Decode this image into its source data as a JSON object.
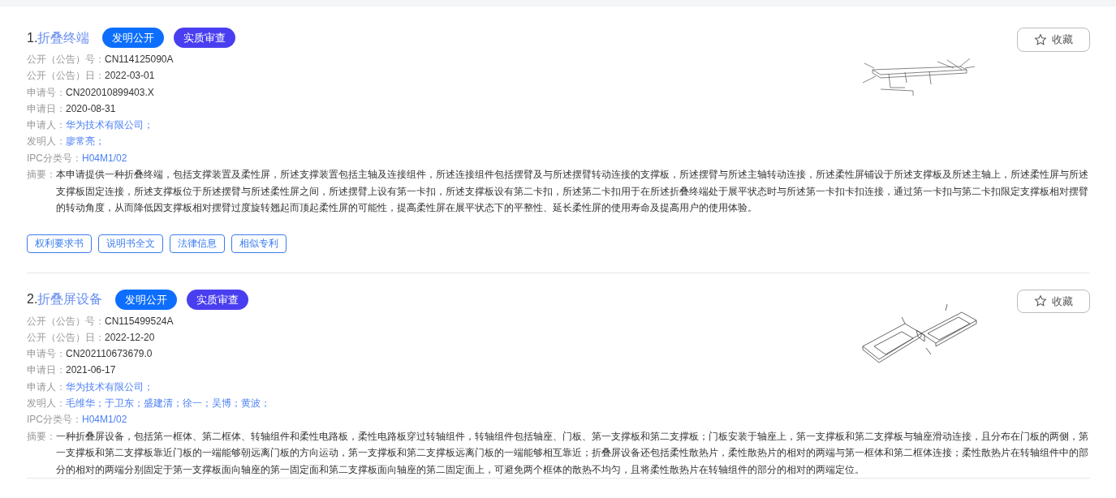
{
  "results": [
    {
      "index": "1.",
      "title": "折叠终端",
      "tags": [
        {
          "label": "发明公开",
          "color": "#0d6efd"
        },
        {
          "label": "实质审查",
          "color": "#4a3ff0"
        }
      ],
      "favorite": "收藏",
      "fields": [
        {
          "label": "公开（公告）号：",
          "kind": "plain",
          "values": [
            "CN114125090A"
          ]
        },
        {
          "label": "公开（公告）日：",
          "kind": "plain",
          "values": [
            "2022-03-01"
          ]
        },
        {
          "label": "申请号：",
          "kind": "plain",
          "values": [
            "CN202010899403.X"
          ]
        },
        {
          "label": "申请日：",
          "kind": "plain",
          "values": [
            "2020-08-31"
          ]
        },
        {
          "label": "申请人：",
          "kind": "link",
          "values": [
            "华为技术有限公司；"
          ]
        },
        {
          "label": "发明人：",
          "kind": "link",
          "values": [
            "廖常亮；"
          ]
        },
        {
          "label": "IPC分类号：",
          "kind": "link",
          "values": [
            "H04M1/02"
          ]
        }
      ],
      "abstract_label": "摘要：",
      "abstract": "本申请提供一种折叠终端，包括支撑装置及柔性屏，所述支撑装置包括主轴及连接组件，所述连接组件包括摆臂及与所述摆臂转动连接的支撑板，所述摆臂与所述主轴转动连接，所述柔性屏铺设于所述支撑板及所述主轴上，所述柔性屏与所述支撑板固定连接，所述支撑板位于所述摆臂与所述柔性屏之间，所述摆臂上设有第一卡扣，所述支撑板设有第二卡扣，所述第二卡扣用于在所述折叠终端处于展平状态时与所述第一卡扣卡扣连接，通过第一卡扣与第二卡扣限定支撑板相对摆臂的转动角度，从而降低因支撑板相对摆臂过度旋转翘起而顶起柔性屏的可能性，提高柔性屏在展平状态下的平整性、延长柔性屏的使用寿命及提高用户的使用体验。",
      "kind": "flat",
      "actions": [
        "权利要求书",
        "说明书全文",
        "法律信息",
        "相似专利"
      ]
    },
    {
      "index": "2.",
      "title": "折叠屏设备",
      "tags": [
        {
          "label": "发明公开",
          "color": "#0d6efd"
        },
        {
          "label": "实质审查",
          "color": "#4a3ff0"
        }
      ],
      "favorite": "收藏",
      "fields": [
        {
          "label": "公开（公告）号：",
          "kind": "plain",
          "values": [
            "CN115499524A"
          ]
        },
        {
          "label": "公开（公告）日：",
          "kind": "plain",
          "values": [
            "2022-12-20"
          ]
        },
        {
          "label": "申请号：",
          "kind": "plain",
          "values": [
            "CN202110673679.0"
          ]
        },
        {
          "label": "申请日：",
          "kind": "plain",
          "values": [
            "2021-06-17"
          ]
        },
        {
          "label": "申请人：",
          "kind": "link",
          "values": [
            "华为技术有限公司；"
          ]
        },
        {
          "label": "发明人：",
          "kind": "link",
          "values": [
            "毛维华；",
            "于卫东；",
            "盛建清；",
            "徐一；",
            "吴博；",
            "黄波；"
          ]
        },
        {
          "label": "IPC分类号：",
          "kind": "link",
          "values": [
            "H04M1/02"
          ]
        }
      ],
      "abstract_label": "摘要：",
      "abstract": "一种折叠屏设备，包括第一框体、第二框体、转轴组件和柔性电路板，柔性电路板穿过转轴组件，转轴组件包括轴座、门板、第一支撑板和第二支撑板；门板安装于轴座上，第一支撑板和第二支撑板与轴座滑动连接，且分布在门板的两侧，第一支撑板和第二支撑板靠近门板的一端能够朝远离门板的方向运动，第一支撑板和第二支撑板远离门板的一端能够相互靠近；折叠屏设备还包括柔性散热片，柔性散热片的相对的两端与第一框体和第二框体连接；柔性散热片在转轴组件中的部分的相对的两端分别固定于第一支撑板面向轴座的第一固定面和第二支撑板面向轴座的第二固定面上，可避免两个框体的散热不均匀，且将柔性散热片在转轴组件的部分的相对的两端定位。",
      "kind": "open"
    }
  ]
}
